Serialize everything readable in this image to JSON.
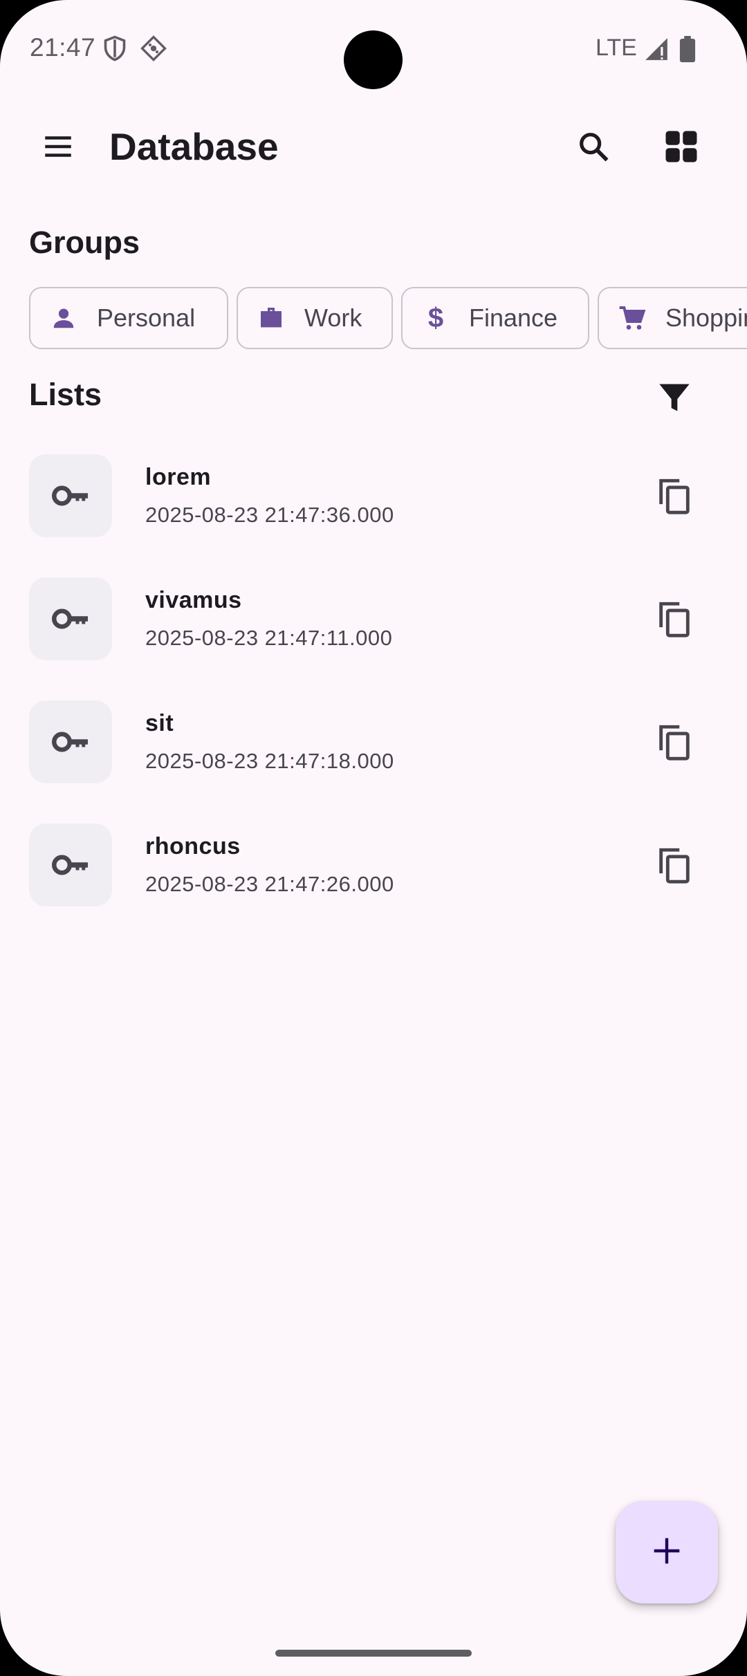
{
  "status_bar": {
    "time": "21:47",
    "network": "LTE",
    "icons": [
      "shield-icon",
      "vpn-key-icon",
      "signal-icon",
      "battery-icon"
    ]
  },
  "app_bar": {
    "title": "Database",
    "icons": [
      "menu-icon",
      "search-icon",
      "grid-view-icon"
    ]
  },
  "groups": {
    "title": "Groups",
    "chips": [
      {
        "label": "Personal",
        "icon": "person-icon"
      },
      {
        "label": "Work",
        "icon": "briefcase-icon"
      },
      {
        "label": "Finance",
        "icon": "dollar-icon"
      },
      {
        "label": "Shopping",
        "icon": "cart-icon"
      }
    ]
  },
  "lists": {
    "title": "Lists",
    "filter_icon": "filter-icon",
    "items": [
      {
        "title": "lorem",
        "subtitle": "2025-08-23 21:47:36.000"
      },
      {
        "title": "vivamus",
        "subtitle": "2025-08-23 21:47:11.000"
      },
      {
        "title": "sit",
        "subtitle": "2025-08-23 21:47:18.000"
      },
      {
        "title": "rhoncus",
        "subtitle": "2025-08-23 21:47:26.000"
      }
    ]
  },
  "fab": {
    "icon": "add-icon"
  },
  "colors": {
    "background": "#fdf7fc",
    "accent": "#6a4f9a",
    "fab": "#eaddff",
    "text_primary": "#1d1b20",
    "text_secondary": "#49454f"
  }
}
